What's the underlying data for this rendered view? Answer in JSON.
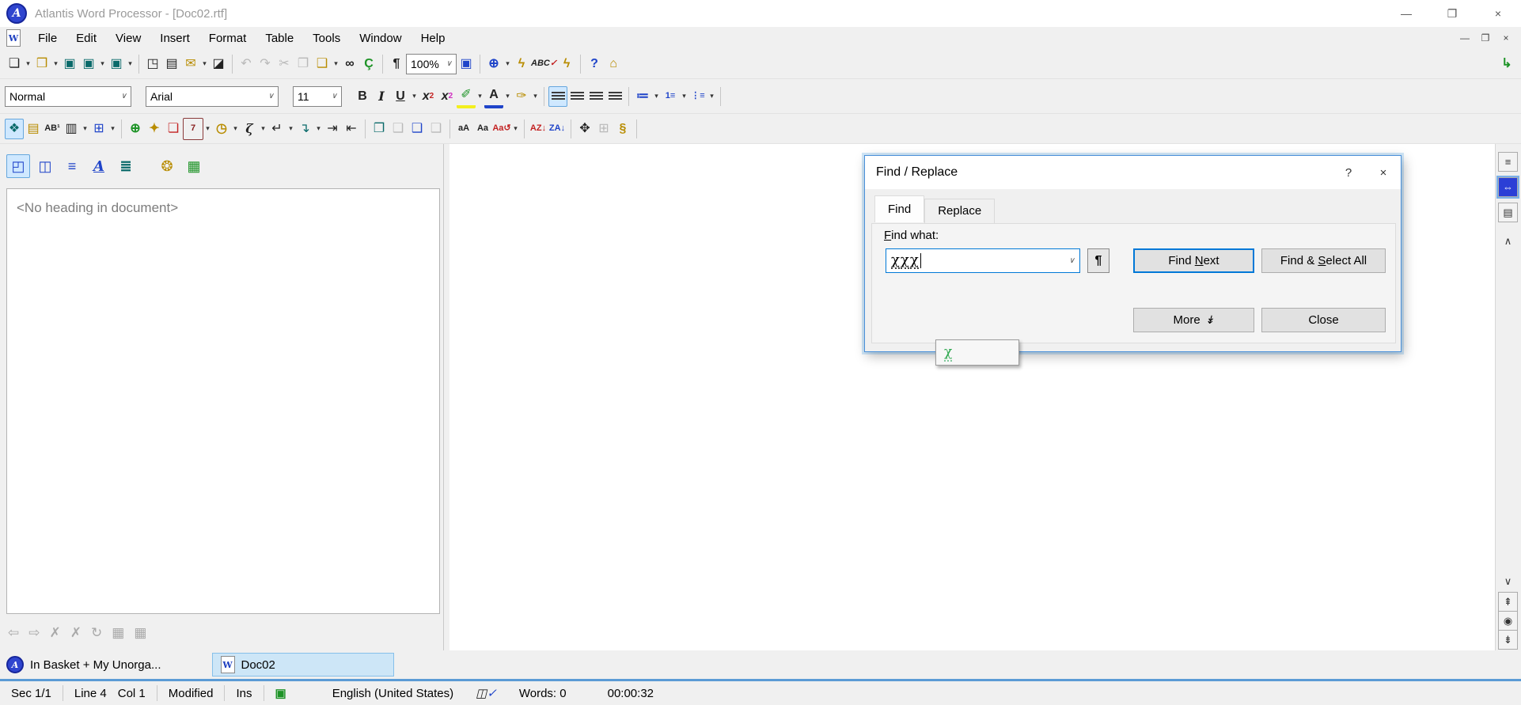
{
  "window": {
    "title": "Atlantis Word Processor - [Doc02.rtf]"
  },
  "menu": {
    "items": [
      "File",
      "Edit",
      "View",
      "Insert",
      "Format",
      "Table",
      "Tools",
      "Window",
      "Help"
    ]
  },
  "toolbar1": {
    "zoom_value": "100%"
  },
  "formatting": {
    "style": "Normal",
    "font": "Arial",
    "size": "11"
  },
  "headings_panel": {
    "empty_text": "<No heading in document>"
  },
  "dialog": {
    "title": "Find / Replace",
    "tabs": [
      "Find",
      "Replace"
    ],
    "active_tab": "Find",
    "find_what": {
      "key": "F",
      "post": "ind what:"
    },
    "input_chars": [
      "χ",
      "χ",
      "χ"
    ],
    "suggestion": "χ",
    "find_next": {
      "pre": "Find ",
      "key": "N",
      "post": "ext"
    },
    "select_all": {
      "pre": "Find & ",
      "key": "S",
      "post": "elect All"
    },
    "more_label": "More",
    "close_label": "Close",
    "help_glyph": "?"
  },
  "document_bar": {
    "organizer": "In Basket + My Unorga...",
    "doc_tab": "Doc02"
  },
  "status_bar": {
    "sec": "Sec 1/1",
    "line": "Line 4",
    "col": "Col 1",
    "modified": "Modified",
    "ins": "Ins",
    "language": "English (United States)",
    "words": "Words: 0",
    "time": "00:00:32"
  },
  "colors": {
    "accent": "#0078d7",
    "selected_bg": "#cfe8ff",
    "tab_bg": "#cde6f7",
    "status_separator": "#5b9bd5"
  },
  "icons": {
    "app_logo": "A",
    "doc_w": "W",
    "minimize": "—",
    "restore": "❐",
    "close": "×",
    "help_q": "?",
    "dd": "▾",
    "combo_arrow": "∨",
    "new_doc": "❏",
    "open": "❒",
    "save": "▣",
    "save_all": "▣",
    "save_plus": "▣",
    "print_preview": "◳",
    "print": "▤",
    "email": "✉",
    "mail_card": "◪",
    "undo": "↶",
    "redo": "↷",
    "cut": "✂",
    "copy": "❐",
    "paste": "❑",
    "find": "∞",
    "replace": "Ç",
    "pilcrow": "¶",
    "fullscreen": "▣",
    "web": "⊕",
    "lightning": "ϟ",
    "abc": "ABC",
    "check": "✓",
    "home": "⌂",
    "jump": "↳",
    "bold": "B",
    "italic": "I",
    "underline": "U",
    "sup_x": "x",
    "sup_2": "2",
    "sub_x": "x",
    "sub_2": "2",
    "highlight": "✐",
    "font_color": "A",
    "painter": "✑",
    "bullets": "≔",
    "numbering": "1≡",
    "multilevel": "⋮≡",
    "hot_panel": "❖",
    "text_frame": "▤",
    "footnote": "AB¹",
    "columns": "▥",
    "table": "⊞",
    "link": "⊕",
    "bookmark": "✦",
    "doc_red": "❏",
    "date7": "7",
    "time": "◷",
    "zeta": "ζ",
    "br_page": "↵",
    "br_sec": "↴",
    "br_col": "⇥",
    "br_text": "⇤",
    "copy_fmt": "❐",
    "paste_fmt": "❑",
    "paste_sp": "❑",
    "paste_dis": "❑",
    "case_up": "aA",
    "case_cap": "Aa",
    "case_tog": "Aa↺",
    "sort_az": "AZ↓",
    "sort_za": "ZA↓",
    "hand": "✥",
    "table2": "⊞",
    "hyphen": "§",
    "pv": "◰",
    "book": "◫",
    "paras": "≡",
    "styles": "A",
    "hlist": "≣",
    "palette": "❂",
    "stats": "▦",
    "nav_back": "⇦",
    "nav_fwd": "⇨",
    "nav_x1": "✗",
    "nav_x2": "✗",
    "nav_r": "↻",
    "nav_t1": "▦",
    "nav_t2": "▦",
    "strip_lines": "≡",
    "strip_thumbs": "⇔",
    "strip_box": "▤",
    "up": "∧",
    "down": "∨",
    "pgup": "⇞",
    "dot": "◉",
    "pgdn": "⇟",
    "more_dd": "↡",
    "disk_status": "▣",
    "lang_book": "◫"
  }
}
